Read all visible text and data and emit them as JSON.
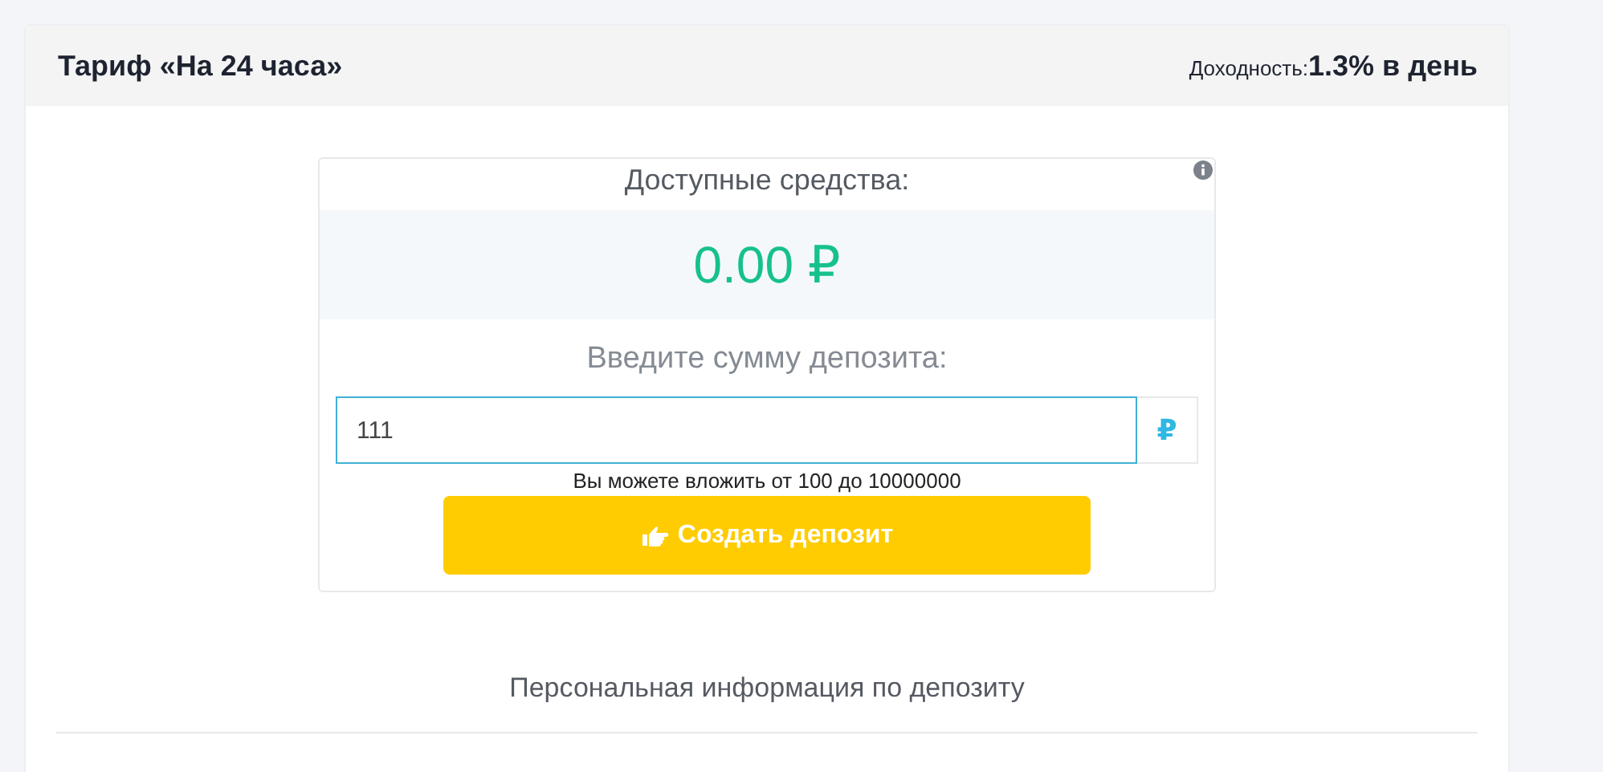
{
  "header": {
    "title": "Тариф «На 24 часа»",
    "yield_label": "Доходность:",
    "yield_value": "1.3% в день"
  },
  "balance": {
    "label": "Доступные средства:",
    "amount": "0.00 ₽"
  },
  "deposit": {
    "label": "Введите сумму депозита:",
    "value": "111",
    "currency": "₽",
    "hint": "Вы можете вложить от 100 до 10000000",
    "button": "Создать депозит"
  },
  "personal_info": {
    "title": "Персональная информация по депозиту"
  }
}
